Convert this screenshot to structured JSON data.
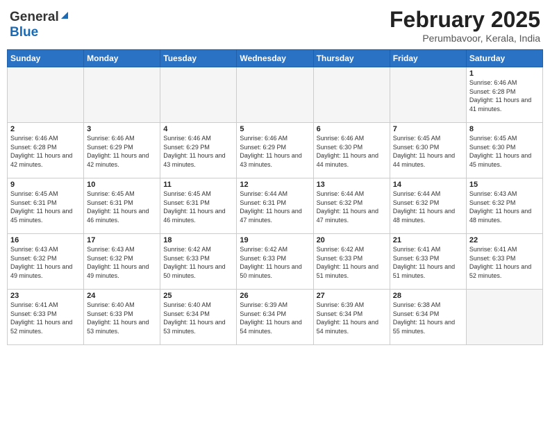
{
  "header": {
    "logo_general": "General",
    "logo_blue": "Blue",
    "month_title": "February 2025",
    "subtitle": "Perumbavoor, Kerala, India"
  },
  "days_of_week": [
    "Sunday",
    "Monday",
    "Tuesday",
    "Wednesday",
    "Thursday",
    "Friday",
    "Saturday"
  ],
  "weeks": [
    [
      {
        "day": "",
        "info": ""
      },
      {
        "day": "",
        "info": ""
      },
      {
        "day": "",
        "info": ""
      },
      {
        "day": "",
        "info": ""
      },
      {
        "day": "",
        "info": ""
      },
      {
        "day": "",
        "info": ""
      },
      {
        "day": "1",
        "info": "Sunrise: 6:46 AM\nSunset: 6:28 PM\nDaylight: 11 hours and 41 minutes."
      }
    ],
    [
      {
        "day": "2",
        "info": "Sunrise: 6:46 AM\nSunset: 6:28 PM\nDaylight: 11 hours and 42 minutes."
      },
      {
        "day": "3",
        "info": "Sunrise: 6:46 AM\nSunset: 6:29 PM\nDaylight: 11 hours and 42 minutes."
      },
      {
        "day": "4",
        "info": "Sunrise: 6:46 AM\nSunset: 6:29 PM\nDaylight: 11 hours and 43 minutes."
      },
      {
        "day": "5",
        "info": "Sunrise: 6:46 AM\nSunset: 6:29 PM\nDaylight: 11 hours and 43 minutes."
      },
      {
        "day": "6",
        "info": "Sunrise: 6:46 AM\nSunset: 6:30 PM\nDaylight: 11 hours and 44 minutes."
      },
      {
        "day": "7",
        "info": "Sunrise: 6:45 AM\nSunset: 6:30 PM\nDaylight: 11 hours and 44 minutes."
      },
      {
        "day": "8",
        "info": "Sunrise: 6:45 AM\nSunset: 6:30 PM\nDaylight: 11 hours and 45 minutes."
      }
    ],
    [
      {
        "day": "9",
        "info": "Sunrise: 6:45 AM\nSunset: 6:31 PM\nDaylight: 11 hours and 45 minutes."
      },
      {
        "day": "10",
        "info": "Sunrise: 6:45 AM\nSunset: 6:31 PM\nDaylight: 11 hours and 46 minutes."
      },
      {
        "day": "11",
        "info": "Sunrise: 6:45 AM\nSunset: 6:31 PM\nDaylight: 11 hours and 46 minutes."
      },
      {
        "day": "12",
        "info": "Sunrise: 6:44 AM\nSunset: 6:31 PM\nDaylight: 11 hours and 47 minutes."
      },
      {
        "day": "13",
        "info": "Sunrise: 6:44 AM\nSunset: 6:32 PM\nDaylight: 11 hours and 47 minutes."
      },
      {
        "day": "14",
        "info": "Sunrise: 6:44 AM\nSunset: 6:32 PM\nDaylight: 11 hours and 48 minutes."
      },
      {
        "day": "15",
        "info": "Sunrise: 6:43 AM\nSunset: 6:32 PM\nDaylight: 11 hours and 48 minutes."
      }
    ],
    [
      {
        "day": "16",
        "info": "Sunrise: 6:43 AM\nSunset: 6:32 PM\nDaylight: 11 hours and 49 minutes."
      },
      {
        "day": "17",
        "info": "Sunrise: 6:43 AM\nSunset: 6:32 PM\nDaylight: 11 hours and 49 minutes."
      },
      {
        "day": "18",
        "info": "Sunrise: 6:42 AM\nSunset: 6:33 PM\nDaylight: 11 hours and 50 minutes."
      },
      {
        "day": "19",
        "info": "Sunrise: 6:42 AM\nSunset: 6:33 PM\nDaylight: 11 hours and 50 minutes."
      },
      {
        "day": "20",
        "info": "Sunrise: 6:42 AM\nSunset: 6:33 PM\nDaylight: 11 hours and 51 minutes."
      },
      {
        "day": "21",
        "info": "Sunrise: 6:41 AM\nSunset: 6:33 PM\nDaylight: 11 hours and 51 minutes."
      },
      {
        "day": "22",
        "info": "Sunrise: 6:41 AM\nSunset: 6:33 PM\nDaylight: 11 hours and 52 minutes."
      }
    ],
    [
      {
        "day": "23",
        "info": "Sunrise: 6:41 AM\nSunset: 6:33 PM\nDaylight: 11 hours and 52 minutes."
      },
      {
        "day": "24",
        "info": "Sunrise: 6:40 AM\nSunset: 6:33 PM\nDaylight: 11 hours and 53 minutes."
      },
      {
        "day": "25",
        "info": "Sunrise: 6:40 AM\nSunset: 6:34 PM\nDaylight: 11 hours and 53 minutes."
      },
      {
        "day": "26",
        "info": "Sunrise: 6:39 AM\nSunset: 6:34 PM\nDaylight: 11 hours and 54 minutes."
      },
      {
        "day": "27",
        "info": "Sunrise: 6:39 AM\nSunset: 6:34 PM\nDaylight: 11 hours and 54 minutes."
      },
      {
        "day": "28",
        "info": "Sunrise: 6:38 AM\nSunset: 6:34 PM\nDaylight: 11 hours and 55 minutes."
      },
      {
        "day": "",
        "info": ""
      }
    ]
  ]
}
